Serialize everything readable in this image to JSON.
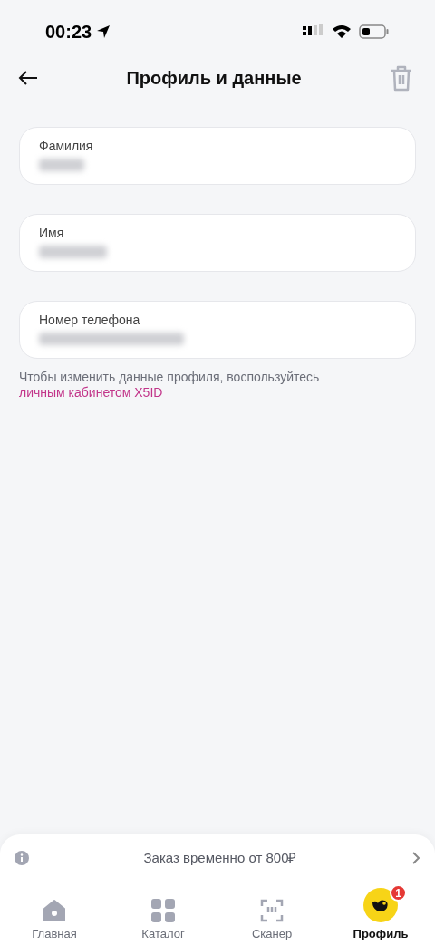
{
  "status_bar": {
    "time": "00:23"
  },
  "header": {
    "title": "Профиль и данные"
  },
  "fields": [
    {
      "label": "Фамилия",
      "value_blurred": true
    },
    {
      "label": "Имя",
      "value_blurred": true
    },
    {
      "label": "Номер телефона",
      "value_blurred": true
    }
  ],
  "hint": {
    "text": "Чтобы изменить данные профиля, воспользуйтесь",
    "link": "личным кабинетом X5ID"
  },
  "banner": {
    "text": "Заказ временно от 800₽"
  },
  "tabs": [
    {
      "kind": "home",
      "label": "Главная",
      "selected": false
    },
    {
      "kind": "catalog",
      "label": "Каталог",
      "selected": false
    },
    {
      "kind": "scanner",
      "label": "Сканер",
      "selected": false
    },
    {
      "kind": "profile",
      "label": "Профиль",
      "selected": true,
      "badge": "1"
    }
  ]
}
